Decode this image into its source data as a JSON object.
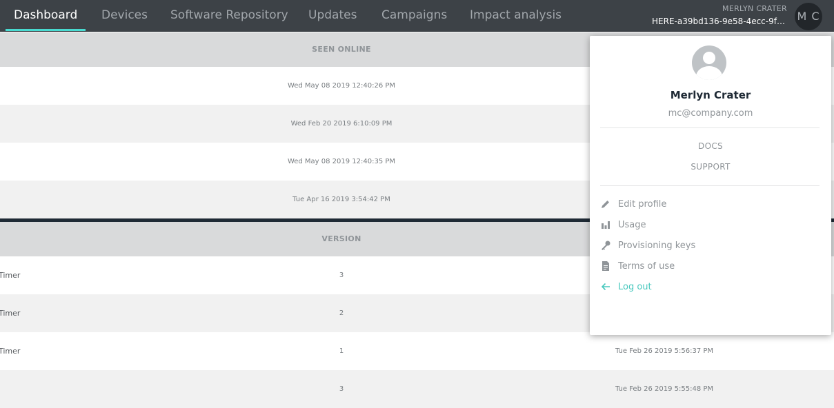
{
  "nav": {
    "tabs": [
      {
        "label": "Dashboard"
      },
      {
        "label": "Devices"
      },
      {
        "label": "Software Repository"
      },
      {
        "label": "Updates"
      },
      {
        "label": "Campaigns"
      },
      {
        "label": "Impact analysis"
      }
    ],
    "active_tab": "Dashboard",
    "user_name": "MERLYN CRATER",
    "namespace": "HERE-a39bd136-9e58-4ecc-9f9e...",
    "avatar_initials": "M C"
  },
  "devices_table": {
    "header": "SEEN ONLINE",
    "rows": [
      {
        "seen_online": "Wed May 08 2019 12:40:26 PM"
      },
      {
        "seen_online": "Wed Feb 20 2019 6:10:09 PM"
      },
      {
        "seen_online": "Wed May 08 2019 12:40:35 PM"
      },
      {
        "seen_online": "Tue Apr 16 2019 3:54:42 PM"
      }
    ]
  },
  "packages_table": {
    "header": "VERSION",
    "rows": [
      {
        "name": "Timer",
        "version": "3",
        "date": ""
      },
      {
        "name": "Timer",
        "version": "2",
        "date": ""
      },
      {
        "name": "Timer",
        "version": "1",
        "date": "Tue Feb 26 2019 5:56:37 PM"
      },
      {
        "name": "",
        "version": "3",
        "date": "Tue Feb 26 2019 5:55:48 PM"
      }
    ]
  },
  "user_menu": {
    "name": "Merlyn Crater",
    "email": "mc@company.com",
    "links": {
      "docs": "DOCS",
      "support": "SUPPORT"
    },
    "items": [
      {
        "label": "Edit profile",
        "icon": "pencil-icon"
      },
      {
        "label": "Usage",
        "icon": "bar-chart-icon"
      },
      {
        "label": "Provisioning keys",
        "icon": "key-icon"
      },
      {
        "label": "Terms of use",
        "icon": "document-icon"
      },
      {
        "label": "Log out",
        "icon": "arrow-left-icon"
      }
    ],
    "colors": {
      "accent": "#48c8be",
      "nav_bg": "#3d4247"
    }
  }
}
